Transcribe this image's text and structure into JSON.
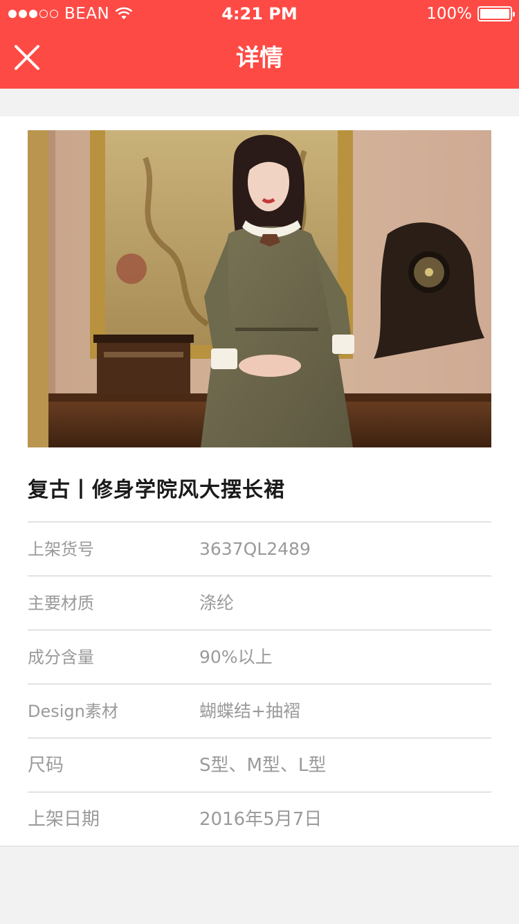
{
  "status_bar": {
    "carrier": "BEAN",
    "time": "4:21 PM",
    "battery": "100%",
    "signal_bars_filled": 3,
    "signal_bars_total": 5
  },
  "nav": {
    "title": "详情",
    "close_icon": "close-icon"
  },
  "colors": {
    "header_bg": "#fe4a45",
    "page_bg": "#f2f2f2",
    "label_text": "#9a9a9a"
  },
  "product": {
    "title": "复古丨修身学院风大摆长裙",
    "specs": [
      {
        "label": "上架货号",
        "value": "3637QL2489"
      },
      {
        "label": "主要材质",
        "value": "涤纶"
      },
      {
        "label": "成分含量",
        "value": "90%以上"
      },
      {
        "label": "Design素材",
        "value": "蝴蝶结+抽褶"
      },
      {
        "label": "尺码",
        "value": "S型、M型、L型"
      },
      {
        "label": "上架日期",
        "value": "2016年5月7日"
      }
    ]
  }
}
